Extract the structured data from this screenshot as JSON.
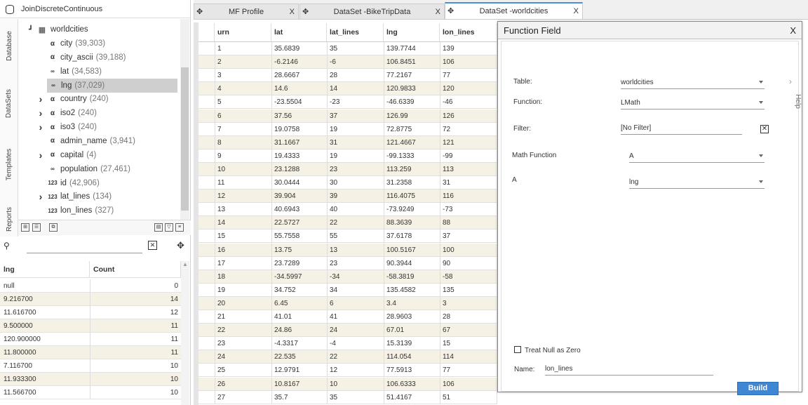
{
  "project": {
    "title": "JoinDiscreteContinuous"
  },
  "side_tabs": [
    "Database",
    "DataSets",
    "Templates",
    "Reports"
  ],
  "tree": {
    "root": "worldcities",
    "fields": [
      {
        "type": "α",
        "name": "city",
        "count": "(39,303)",
        "expand": false
      },
      {
        "type": "α",
        "name": "city_ascii",
        "count": "(39,188)",
        "expand": false
      },
      {
        "type": "∞",
        "name": "lat",
        "count": "(34,583)",
        "expand": false
      },
      {
        "type": "∞",
        "name": "lng",
        "count": "(37,029)",
        "expand": false,
        "selected": true
      },
      {
        "type": "α",
        "name": "country",
        "count": "(240)",
        "expand": true
      },
      {
        "type": "α",
        "name": "iso2",
        "count": "(240)",
        "expand": true
      },
      {
        "type": "α",
        "name": "iso3",
        "count": "(240)",
        "expand": true
      },
      {
        "type": "α",
        "name": "admin_name",
        "count": "(3,941)",
        "expand": false
      },
      {
        "type": "α",
        "name": "capital",
        "count": "(4)",
        "expand": true
      },
      {
        "type": "∞",
        "name": "population",
        "count": "(27,461)",
        "expand": false
      },
      {
        "type": "123",
        "name": "id",
        "count": "(42,906)",
        "expand": false
      },
      {
        "type": "123",
        "name": "lat_lines",
        "count": "(134)",
        "expand": true
      },
      {
        "type": "123",
        "name": "lon_lines",
        "count": "(327)",
        "expand": false
      }
    ]
  },
  "search": {
    "placeholder": "",
    "clear": "✕"
  },
  "stats": {
    "headers": [
      "lng",
      "Count"
    ],
    "rows": [
      [
        "null",
        "0"
      ],
      [
        "9.216700",
        "14"
      ],
      [
        "11.616700",
        "12"
      ],
      [
        "9.500000",
        "11"
      ],
      [
        "120.900000",
        "11"
      ],
      [
        "11.800000",
        "11"
      ],
      [
        "7.116700",
        "10"
      ],
      [
        "11.933300",
        "10"
      ],
      [
        "11.566700",
        "10"
      ]
    ]
  },
  "tabs": [
    {
      "label": "MF Profile",
      "close": "X"
    },
    {
      "label": "DataSet -BikeTripData",
      "close": "X"
    },
    {
      "label": "DataSet -worldcities",
      "close": "X",
      "active": true
    }
  ],
  "grid": {
    "headers": [
      "urn",
      "lat",
      "lat_lines",
      "lng",
      "lon_lines"
    ],
    "rows": [
      [
        "1",
        "35.6839",
        "35",
        "139.7744",
        "139"
      ],
      [
        "2",
        "-6.2146",
        "-6",
        "106.8451",
        "106"
      ],
      [
        "3",
        "28.6667",
        "28",
        "77.2167",
        "77"
      ],
      [
        "4",
        "14.6",
        "14",
        "120.9833",
        "120"
      ],
      [
        "5",
        "-23.5504",
        "-23",
        "-46.6339",
        "-46"
      ],
      [
        "6",
        "37.56",
        "37",
        "126.99",
        "126"
      ],
      [
        "7",
        "19.0758",
        "19",
        "72.8775",
        "72"
      ],
      [
        "8",
        "31.1667",
        "31",
        "121.4667",
        "121"
      ],
      [
        "9",
        "19.4333",
        "19",
        "-99.1333",
        "-99"
      ],
      [
        "10",
        "23.1288",
        "23",
        "113.259",
        "113"
      ],
      [
        "11",
        "30.0444",
        "30",
        "31.2358",
        "31"
      ],
      [
        "12",
        "39.904",
        "39",
        "116.4075",
        "116"
      ],
      [
        "13",
        "40.6943",
        "40",
        "-73.9249",
        "-73"
      ],
      [
        "14",
        "22.5727",
        "22",
        "88.3639",
        "88"
      ],
      [
        "15",
        "55.7558",
        "55",
        "37.6178",
        "37"
      ],
      [
        "16",
        "13.75",
        "13",
        "100.5167",
        "100"
      ],
      [
        "17",
        "23.7289",
        "23",
        "90.3944",
        "90"
      ],
      [
        "18",
        "-34.5997",
        "-34",
        "-58.3819",
        "-58"
      ],
      [
        "19",
        "34.752",
        "34",
        "135.4582",
        "135"
      ],
      [
        "20",
        "6.45",
        "6",
        "3.4",
        "3"
      ],
      [
        "21",
        "41.01",
        "41",
        "28.9603",
        "28"
      ],
      [
        "22",
        "24.86",
        "24",
        "67.01",
        "67"
      ],
      [
        "23",
        "-4.3317",
        "-4",
        "15.3139",
        "15"
      ],
      [
        "24",
        "22.535",
        "22",
        "114.054",
        "114"
      ],
      [
        "25",
        "12.9791",
        "12",
        "77.5913",
        "77"
      ],
      [
        "26",
        "10.8167",
        "10",
        "106.6333",
        "106"
      ],
      [
        "27",
        "35.7",
        "35",
        "51.4167",
        "51"
      ]
    ]
  },
  "dialog": {
    "title": "Function Field",
    "close": "X",
    "help": "Help",
    "table_label": "Table:",
    "table_value": "worldcities",
    "function_label": "Function:",
    "function_value": "LMath",
    "filter_label": "Filter:",
    "filter_value": "[No Filter]",
    "math_label": "Math Function",
    "math_value": "A",
    "a_label": "A",
    "a_value": "lng",
    "treat_null": "Treat Null as Zero",
    "name_label": "Name:",
    "name_value": "lon_lines",
    "build": "Build"
  }
}
